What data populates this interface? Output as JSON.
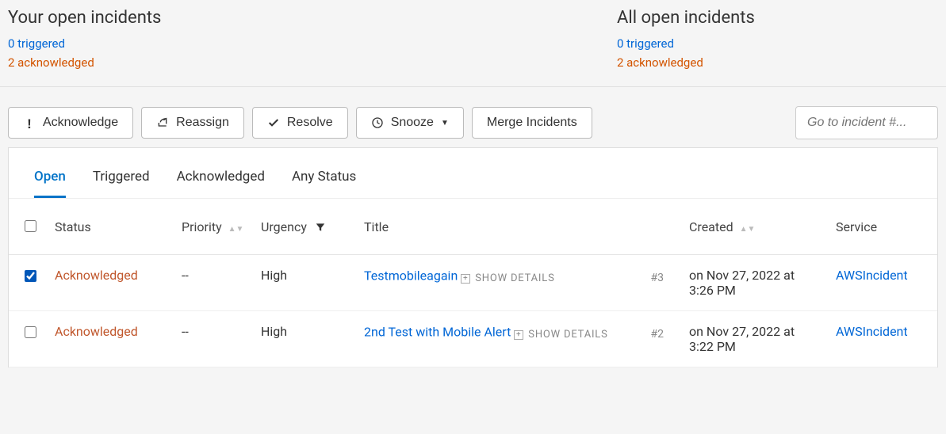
{
  "summary": {
    "your": {
      "title": "Your open incidents",
      "triggered": "0 triggered",
      "acknowledged": "2 acknowledged"
    },
    "all": {
      "title": "All open incidents",
      "triggered": "0 triggered",
      "acknowledged": "2 acknowledged"
    }
  },
  "toolbar": {
    "acknowledge": "Acknowledge",
    "reassign": "Reassign",
    "resolve": "Resolve",
    "snooze": "Snooze",
    "merge": "Merge Incidents",
    "goto_placeholder": "Go to incident #..."
  },
  "tabs": {
    "open": "Open",
    "triggered": "Triggered",
    "acknowledged": "Acknowledged",
    "any": "Any Status"
  },
  "columns": {
    "status": "Status",
    "priority": "Priority",
    "urgency": "Urgency",
    "title": "Title",
    "created": "Created",
    "service": "Service"
  },
  "labels": {
    "show_details": "SHOW DETAILS"
  },
  "rows": [
    {
      "checked": true,
      "status": "Acknowledged",
      "priority": "--",
      "urgency": "High",
      "title": "Testmobileagain",
      "num": "#3",
      "created": "on Nov 27, 2022 at 3:26 PM",
      "service": "AWSIncident"
    },
    {
      "checked": false,
      "status": "Acknowledged",
      "priority": "--",
      "urgency": "High",
      "title": "2nd Test with Mobile Alert",
      "num": "#2",
      "created": "on Nov 27, 2022 at 3:22 PM",
      "service": "AWSIncident"
    }
  ]
}
